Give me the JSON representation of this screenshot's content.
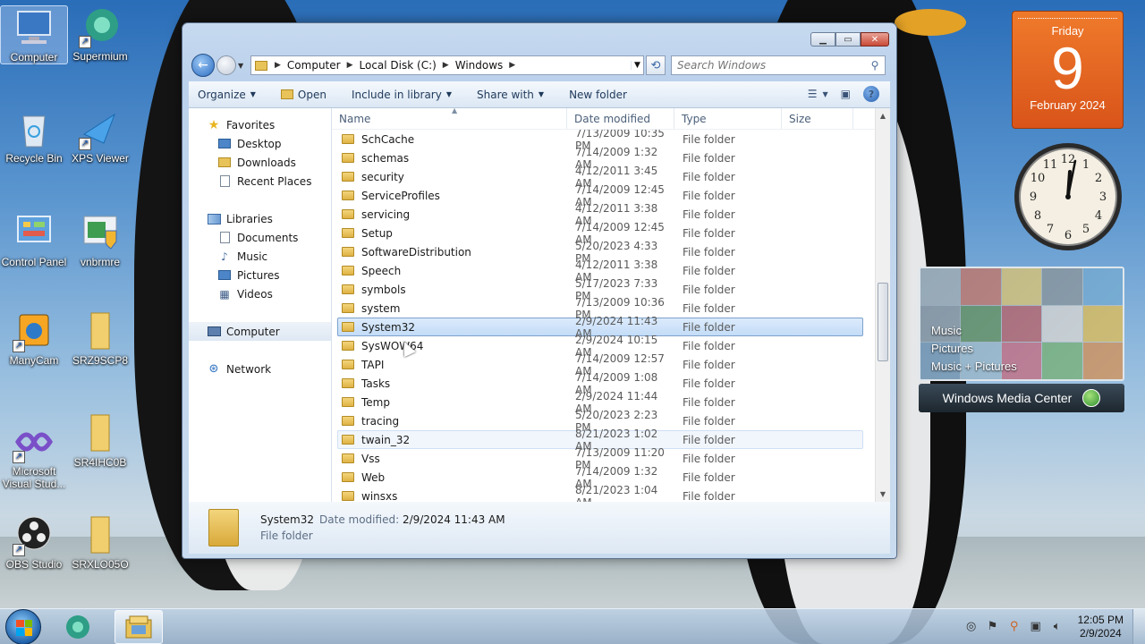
{
  "desktop": {
    "icons": [
      {
        "label": "Computer"
      },
      {
        "label": "Supermium"
      },
      {
        "label": "Recycle Bin"
      },
      {
        "label": "XPS Viewer"
      },
      {
        "label": "Control Panel"
      },
      {
        "label": "vnbrmre"
      },
      {
        "label": "ManyCam"
      },
      {
        "label": "SRZ9SCP8"
      },
      {
        "label": "Microsoft Visual Stud..."
      },
      {
        "label": "SR4IHC0B"
      },
      {
        "label": "OBS Studio"
      },
      {
        "label": "SRXLO05O"
      }
    ]
  },
  "explorer": {
    "address": {
      "crumbs": [
        "Computer",
        "Local Disk (C:)",
        "Windows"
      ]
    },
    "search_placeholder": "Search Windows",
    "toolbar": {
      "organize": "Organize",
      "open": "Open",
      "include_in_library": "Include in library",
      "share_with": "Share with",
      "new_folder": "New folder"
    },
    "nav": {
      "favorites": "Favorites",
      "desktop": "Desktop",
      "downloads": "Downloads",
      "recent_places": "Recent Places",
      "libraries": "Libraries",
      "documents": "Documents",
      "music": "Music",
      "pictures": "Pictures",
      "videos": "Videos",
      "computer": "Computer",
      "network": "Network"
    },
    "columns": {
      "name": "Name",
      "date": "Date modified",
      "type": "Type",
      "size": "Size"
    },
    "files": [
      {
        "name": "SchCache",
        "date": "7/13/2009 10:35 PM",
        "type": "File folder"
      },
      {
        "name": "schemas",
        "date": "7/14/2009 1:32 AM",
        "type": "File folder"
      },
      {
        "name": "security",
        "date": "4/12/2011 3:45 AM",
        "type": "File folder"
      },
      {
        "name": "ServiceProfiles",
        "date": "7/14/2009 12:45 AM",
        "type": "File folder"
      },
      {
        "name": "servicing",
        "date": "4/12/2011 3:38 AM",
        "type": "File folder"
      },
      {
        "name": "Setup",
        "date": "7/14/2009 12:45 AM",
        "type": "File folder"
      },
      {
        "name": "SoftwareDistribution",
        "date": "5/20/2023 4:33 PM",
        "type": "File folder"
      },
      {
        "name": "Speech",
        "date": "4/12/2011 3:38 AM",
        "type": "File folder"
      },
      {
        "name": "symbols",
        "date": "5/17/2023 7:33 PM",
        "type": "File folder"
      },
      {
        "name": "system",
        "date": "7/13/2009 10:36 PM",
        "type": "File folder"
      },
      {
        "name": "System32",
        "date": "2/9/2024 11:43 AM",
        "type": "File folder"
      },
      {
        "name": "SysWOW64",
        "date": "2/9/2024 10:15 AM",
        "type": "File folder"
      },
      {
        "name": "TAPI",
        "date": "7/14/2009 12:57 AM",
        "type": "File folder"
      },
      {
        "name": "Tasks",
        "date": "7/14/2009 1:08 AM",
        "type": "File folder"
      },
      {
        "name": "Temp",
        "date": "2/9/2024 11:44 AM",
        "type": "File folder"
      },
      {
        "name": "tracing",
        "date": "5/20/2023 2:23 PM",
        "type": "File folder"
      },
      {
        "name": "twain_32",
        "date": "8/21/2023 1:02 AM",
        "type": "File folder"
      },
      {
        "name": "Vss",
        "date": "7/13/2009 11:20 PM",
        "type": "File folder"
      },
      {
        "name": "Web",
        "date": "7/14/2009 1:32 AM",
        "type": "File folder"
      },
      {
        "name": "winsxs",
        "date": "8/21/2023 1:04 AM",
        "type": "File folder"
      }
    ],
    "details": {
      "name": "System32",
      "date_label": "Date modified:",
      "date_value": "2/9/2024 11:43 AM",
      "type": "File folder"
    }
  },
  "gadgets": {
    "calendar": {
      "weekday": "Friday",
      "day": "9",
      "month_year": "February 2024"
    },
    "media_center": {
      "items": [
        "Music",
        "Pictures",
        "Music + Pictures"
      ],
      "title": "Windows Media Center"
    }
  },
  "taskbar": {
    "time": "12:05 PM",
    "date": "2/9/2024"
  }
}
